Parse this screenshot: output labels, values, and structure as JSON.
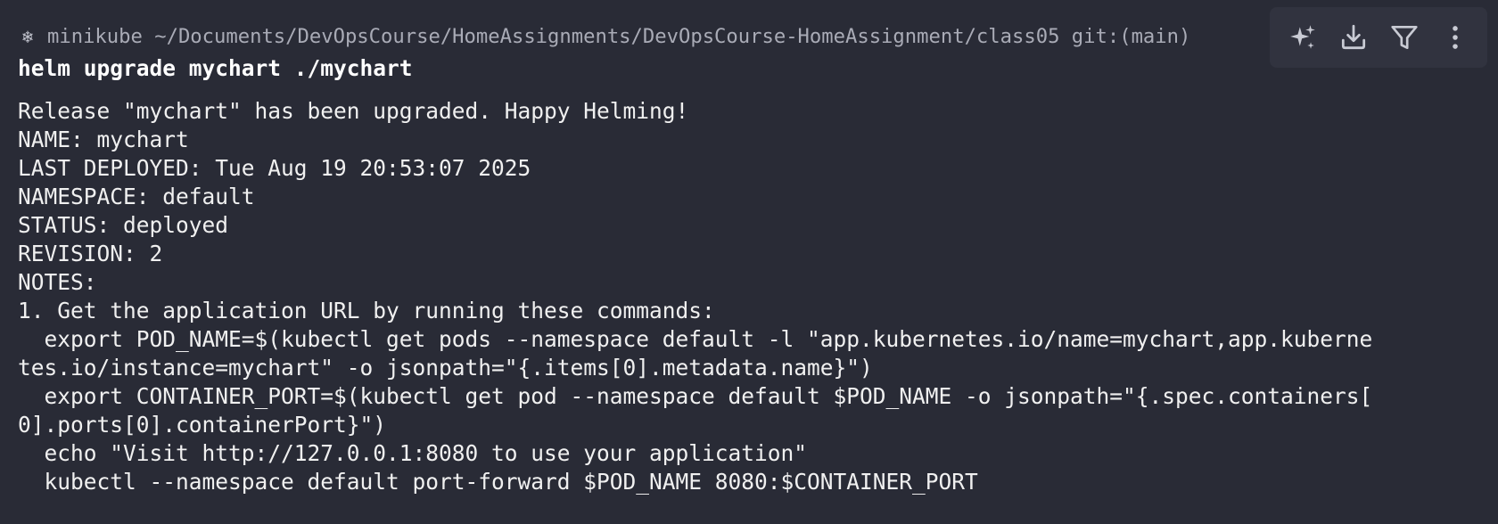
{
  "prompt": {
    "icon": "kubernetes-helm-icon",
    "text": "minikube ~/Documents/DevOpsCourse/HomeAssignments/DevOpsCourse-HomeAssignment/class05 git:(main)"
  },
  "command": "helm upgrade mychart ./mychart",
  "output_lines": [
    "Release \"mychart\" has been upgraded. Happy Helming!",
    "NAME: mychart",
    "LAST DEPLOYED: Tue Aug 19 20:53:07 2025",
    "NAMESPACE: default",
    "STATUS: deployed",
    "REVISION: 2",
    "NOTES:",
    "1. Get the application URL by running these commands:",
    "  export POD_NAME=$(kubectl get pods --namespace default -l \"app.kubernetes.io/name=mychart,app.kuberne",
    "tes.io/instance=mychart\" -o jsonpath=\"{.items[0].metadata.name}\")",
    "  export CONTAINER_PORT=$(kubectl get pod --namespace default $POD_NAME -o jsonpath=\"{.spec.containers[",
    "0].ports[0].containerPort}\")",
    "  echo \"Visit http://127.0.0.1:8080 to use your application\"",
    "  kubectl --namespace default port-forward $POD_NAME 8080:$CONTAINER_PORT"
  ],
  "toolbar": {
    "icons": [
      "sparkle-icon",
      "download-icon",
      "filter-icon",
      "more-vertical-icon"
    ]
  },
  "colors": {
    "background": "#292b36",
    "toolbar_bg": "#31333f",
    "prompt_text": "#a9abb6",
    "command_text": "#ffffff",
    "output_text": "#f0f0f0",
    "icon": "#c9cbd4"
  }
}
